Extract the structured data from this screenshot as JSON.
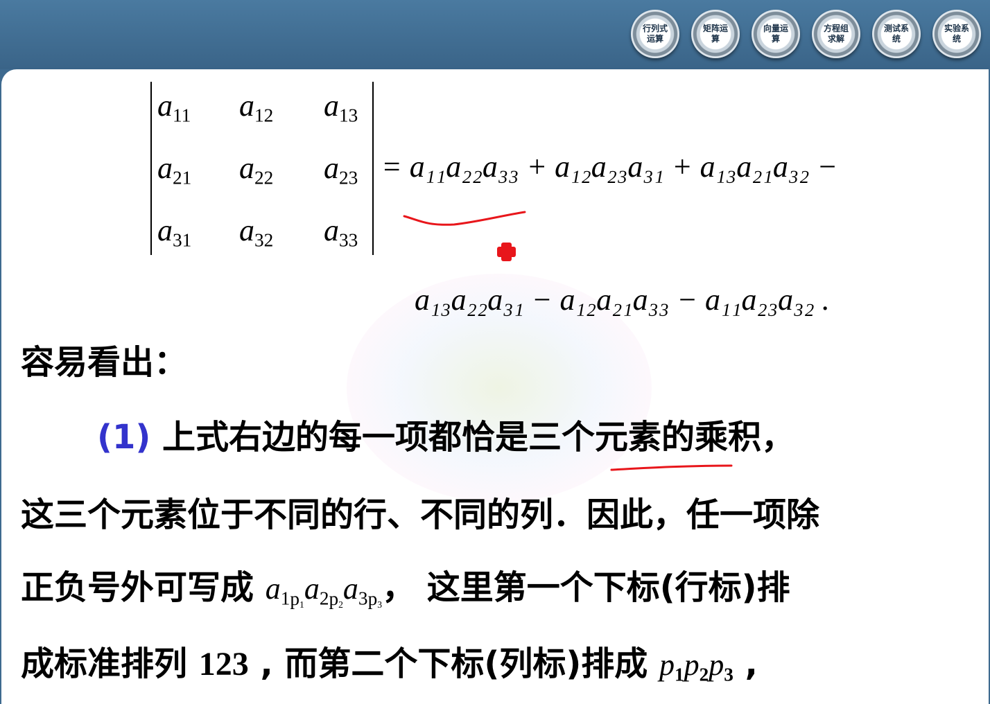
{
  "nav": [
    {
      "label": "行列式运算"
    },
    {
      "label": "矩阵运算"
    },
    {
      "label": "向量运算"
    },
    {
      "label": "方程组求解"
    },
    {
      "label": "测试系统"
    },
    {
      "label": "实验系统"
    }
  ],
  "det": {
    "cells": [
      [
        "11",
        "12",
        "13"
      ],
      [
        "21",
        "22",
        "23"
      ],
      [
        "31",
        "32",
        "33"
      ]
    ],
    "var": "a"
  },
  "expansion": {
    "line1": "= a₁₁a₂₂a₃₃ + a₁₂a₂₃a₃₁ + a₁₃a₂₁a₃₂ −",
    "line2": "a₁₃a₂₂a₃₁ − a₁₂a₂₁a₃₃ − a₁₁a₂₃a₃₂ ."
  },
  "text": {
    "intro": "容易看出：",
    "item_num": "(1)",
    "line1": "上式右边的每一项都恰是三个元素的乘积，",
    "line2": "这三个元素位于不同的行、不同的列．因此，任一项除",
    "line3_a": "正负号外可写成",
    "line3_math": "a1p1 a2p2 a3p3",
    "line3_b": "，  这里第一个下标(行标)排",
    "line4_a": "成标准排列",
    "line4_num": "123",
    "line4_b": ", 而第二个下标(列标)排成",
    "line4_math": "p1p2p3",
    "line4_c": ","
  },
  "colors": {
    "topbar": "#3e6a8f",
    "annotation": "#e8161b",
    "item_number": "#3333cc"
  }
}
